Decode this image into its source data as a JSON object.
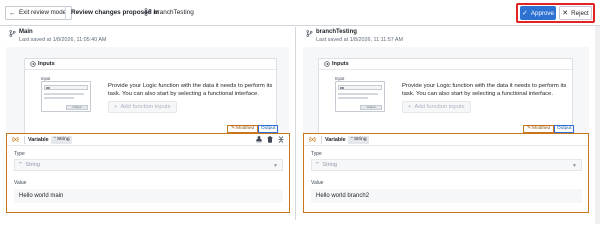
{
  "toolbar": {
    "exit_label": "Exit review mode",
    "review_label": "Review changes proposed in",
    "branch": "branchTesting",
    "approve_label": "Approve",
    "reject_label": "Reject"
  },
  "colors": {
    "accent": "#2d72d2",
    "highlight": "#e02424",
    "modified": "#c87619"
  },
  "left": {
    "title": "Main",
    "saved": "Last saved at 1/8/2026, 11:05:40 AM",
    "inputs_title": "Inputs",
    "illus_input": "Input",
    "illus_output": "Output",
    "description": "Provide your Logic function with the data it needs to perform its task. You can also start by selecting a functional interface.",
    "add_label": "Add function inputs",
    "modified_label": "Modified",
    "output_label": "Output",
    "var_label": "Variable",
    "type_pill": "String",
    "type_field_label": "Type",
    "type_value": "String",
    "value_field_label": "Value",
    "value": "Hello world main"
  },
  "right": {
    "title": "branchTesting",
    "saved": "Last saved at 1/8/2026, 11:11:57 AM",
    "inputs_title": "Inputs",
    "illus_input": "Input",
    "illus_output": "Output",
    "description": "Provide your Logic function with the data it needs to perform its task. You can also start by selecting a functional interface.",
    "add_label": "Add function inputs",
    "modified_label": "Modified",
    "output_label": "Output",
    "var_label": "Variable",
    "type_pill": "String",
    "type_field_label": "Type",
    "type_value": "String",
    "value_field_label": "Value",
    "value": "Hello world branch2"
  }
}
